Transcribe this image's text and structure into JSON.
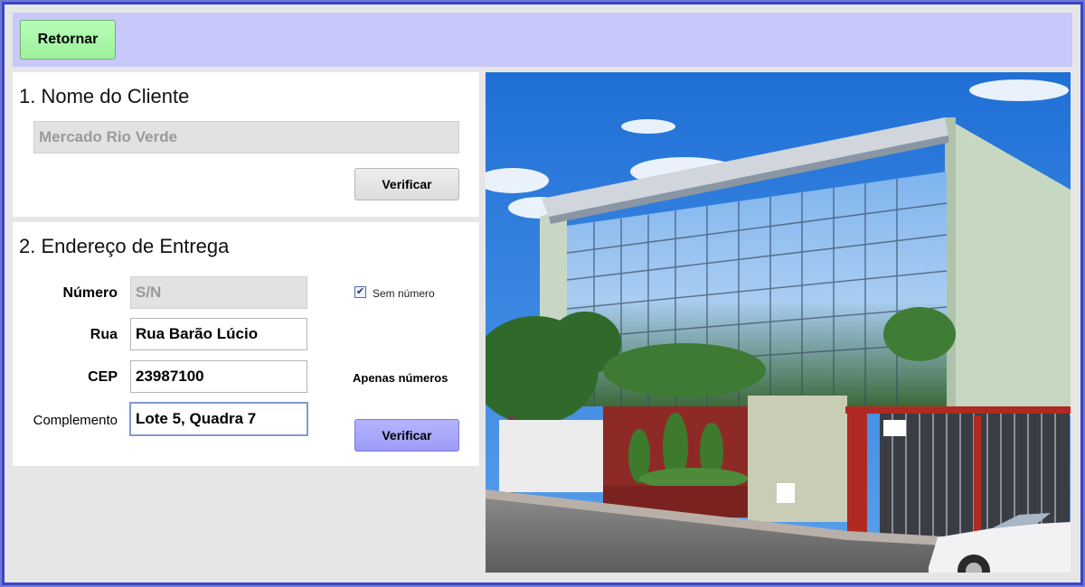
{
  "toolbar": {
    "return_label": "Retornar"
  },
  "client": {
    "title": "1. Nome do Cliente",
    "name_value": "Mercado Rio Verde",
    "verify_label": "Verificar"
  },
  "address": {
    "title": "2. Endereço de Entrega",
    "numero_label": "Número",
    "numero_value": "S/N",
    "sem_numero_label": "Sem número",
    "sem_numero_checked": true,
    "rua_label": "Rua",
    "rua_value": "Rua Barão Lúcio",
    "cep_label": "CEP",
    "cep_value": "23987100",
    "cep_hint": "Apenas números",
    "complemento_label": "Complemento",
    "complemento_value": "Lote 5, Quadra 7",
    "verify_label": "Verificar"
  },
  "colors": {
    "accent_blue": "#9c9cf6",
    "return_green": "#9ef09e",
    "topbar": "#c8c8fa"
  }
}
